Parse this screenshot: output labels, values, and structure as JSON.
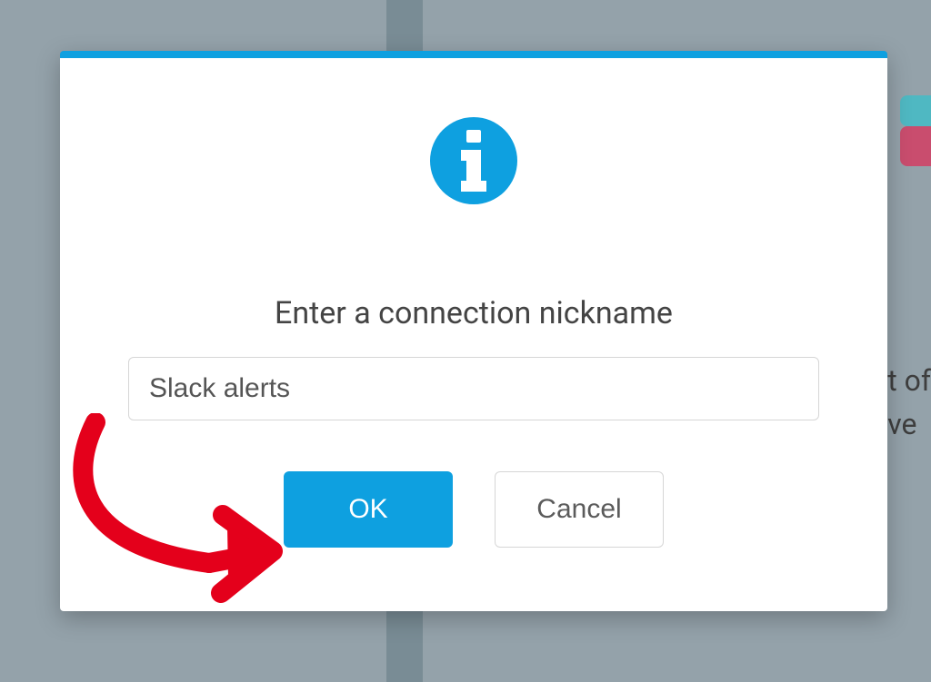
{
  "modal": {
    "title": "Enter a connection nickname",
    "input_value": "Slack alerts",
    "ok_label": "OK",
    "cancel_label": "Cancel"
  },
  "colors": {
    "accent": "#0ea0e0",
    "annotation": "#e4001b"
  },
  "background": {
    "text_line1": "t of",
    "text_line2": "ve"
  }
}
